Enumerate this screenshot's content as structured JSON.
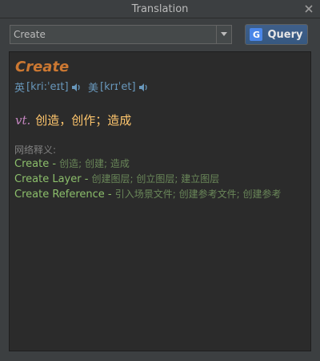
{
  "window": {
    "title": "Translation"
  },
  "toolbar": {
    "combo_value": "Create",
    "query_label": "Query"
  },
  "entry": {
    "word": "Create",
    "phonetics": [
      {
        "region": "英",
        "ipa": "[kri:ˈeɪt]"
      },
      {
        "region": "美",
        "ipa": "[krɪˈet]"
      }
    ],
    "pos": "vt.",
    "definition": "创造，创作；造成"
  },
  "web": {
    "title": "网络释义:",
    "items": [
      {
        "term": "Create",
        "meaning": "创造; 创建; 造成"
      },
      {
        "term": "Create Layer",
        "meaning": "创建图层; 创立图层; 建立图层"
      },
      {
        "term": "Create Reference",
        "meaning": "引入场景文件; 创建参考文件; 创建参考"
      }
    ]
  },
  "colors": {
    "accent": "#cc7832",
    "definition": "#ffc66d",
    "term": "#8cbf6b",
    "button": "#365880"
  }
}
